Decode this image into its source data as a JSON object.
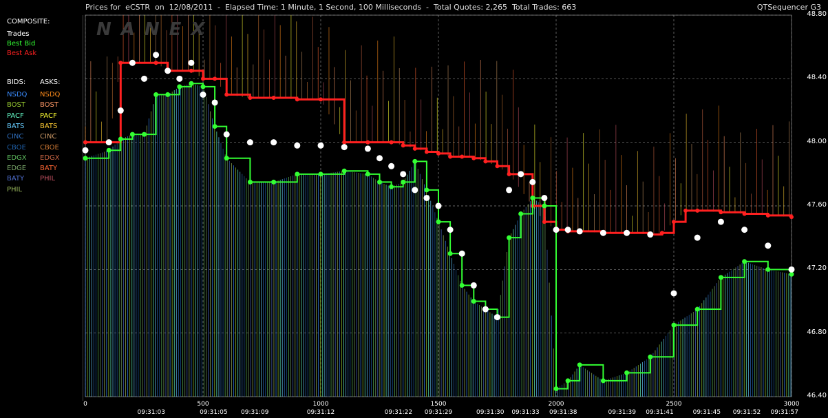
{
  "header": {
    "title": "Prices for  eCSTR  on  12/08/2011  -  Elapsed Time: 1 Minute, 1 Second, 100 Milliseconds  -  Total Quotes: 2,265  Total Trades: 663",
    "app": "QTSequencer G3",
    "watermark": "NANEX"
  },
  "legend": {
    "composite_label": "COMPOSITE:",
    "trades": "Trades",
    "best_bid": "Best Bid",
    "best_ask": "Best Ask",
    "bids_label": "BIDS:",
    "asks_label": "ASKS:",
    "bids": [
      "NSDQ",
      "BOST",
      "PACF",
      "BATS",
      "CINC",
      "CBOE",
      "EDGX",
      "EDGE",
      "BATY",
      "PHIL"
    ],
    "asks": [
      "NSDQ",
      "BOST",
      "PACF",
      "BATS",
      "CINC",
      "CBOE",
      "EDGX",
      "BATY",
      "PHIL"
    ],
    "bid_colors": [
      "#3a8cff",
      "#9acd32",
      "#66ffcc",
      "#66ccff",
      "#2f6fbf",
      "#1e5fa8",
      "#5fbf5f",
      "#7aa86a",
      "#4f6fd0",
      "#a0c060"
    ],
    "ask_colors": [
      "#ff8c1a",
      "#ff9966",
      "#ffff33",
      "#ffcc33",
      "#cc9966",
      "#cc7733",
      "#cc6644",
      "#ff6633",
      "#cc5566"
    ]
  },
  "colors": {
    "trades": "#ffffff",
    "best_bid": "#33ff33",
    "best_ask": "#ff2020",
    "grid": "#888888"
  },
  "chart_data": {
    "type": "line",
    "title": "",
    "ylim": [
      46.4,
      48.8
    ],
    "yticks": [
      "48.80",
      "48.40",
      "48.00",
      "47.60",
      "47.20",
      "46.80",
      "46.40"
    ],
    "xlim": [
      0,
      3000
    ],
    "xticks": [
      "0",
      "500",
      "1000",
      "1500",
      "2000",
      "2500",
      "3000"
    ],
    "time_labels": [
      {
        "x": 280,
        "label": "09:31:03"
      },
      {
        "x": 545,
        "label": "09:31:05"
      },
      {
        "x": 720,
        "label": "09:31:09"
      },
      {
        "x": 1000,
        "label": "09:31:12"
      },
      {
        "x": 1330,
        "label": "09:31:22"
      },
      {
        "x": 1500,
        "label": "09:31:29"
      },
      {
        "x": 1720,
        "label": "09:31:30"
      },
      {
        "x": 1870,
        "label": "09:31:33"
      },
      {
        "x": 2030,
        "label": "09:31:38"
      },
      {
        "x": 2280,
        "label": "09:31:39"
      },
      {
        "x": 2440,
        "label": "09:31:41"
      },
      {
        "x": 2640,
        "label": "09:31:45"
      },
      {
        "x": 2810,
        "label": "09:31:52"
      },
      {
        "x": 2970,
        "label": "09:31:57"
      }
    ],
    "series": [
      {
        "name": "Best Ask",
        "x": [
          0,
          100,
          150,
          300,
          350,
          450,
          500,
          550,
          600,
          700,
          800,
          900,
          1000,
          1100,
          1200,
          1300,
          1350,
          1400,
          1450,
          1500,
          1550,
          1600,
          1650,
          1700,
          1750,
          1800,
          1900,
          1950,
          2000,
          2050,
          2100,
          2200,
          2300,
          2400,
          2450,
          2500,
          2550,
          2600,
          2700,
          2800,
          2900,
          3000
        ],
        "values": [
          48.0,
          48.0,
          48.5,
          48.5,
          48.45,
          48.45,
          48.4,
          48.4,
          48.3,
          48.28,
          48.28,
          48.27,
          48.27,
          48.0,
          48.0,
          48.0,
          47.98,
          47.96,
          47.94,
          47.93,
          47.91,
          47.91,
          47.9,
          47.88,
          47.85,
          47.8,
          47.6,
          47.5,
          47.45,
          47.44,
          47.44,
          47.43,
          47.43,
          47.42,
          47.43,
          47.5,
          47.57,
          47.57,
          47.56,
          47.55,
          47.54,
          47.53
        ]
      },
      {
        "name": "Best Bid",
        "x": [
          0,
          100,
          150,
          200,
          250,
          300,
          350,
          400,
          450,
          500,
          550,
          600,
          700,
          800,
          900,
          1000,
          1100,
          1200,
          1250,
          1300,
          1350,
          1400,
          1450,
          1500,
          1550,
          1600,
          1650,
          1700,
          1750,
          1800,
          1850,
          1900,
          1950,
          2000,
          2050,
          2100,
          2200,
          2300,
          2400,
          2500,
          2600,
          2700,
          2800,
          2900,
          3000
        ],
        "values": [
          47.9,
          47.95,
          48.02,
          48.05,
          48.05,
          48.3,
          48.3,
          48.35,
          48.37,
          48.35,
          48.1,
          47.9,
          47.75,
          47.75,
          47.8,
          47.8,
          47.82,
          47.8,
          47.75,
          47.72,
          47.75,
          47.88,
          47.7,
          47.5,
          47.3,
          47.1,
          47.0,
          46.95,
          46.9,
          47.4,
          47.55,
          47.65,
          47.6,
          46.45,
          46.5,
          46.6,
          46.5,
          46.55,
          46.65,
          46.85,
          46.95,
          47.15,
          47.25,
          47.2,
          47.17
        ]
      },
      {
        "name": "Trades",
        "x": [
          0,
          100,
          150,
          200,
          250,
          300,
          350,
          400,
          450,
          500,
          550,
          600,
          700,
          800,
          900,
          1000,
          1100,
          1200,
          1250,
          1300,
          1350,
          1400,
          1450,
          1500,
          1550,
          1600,
          1650,
          1700,
          1750,
          1800,
          1850,
          1900,
          1950,
          2000,
          2050,
          2100,
          2200,
          2300,
          2400,
          2500,
          2600,
          2700,
          2800,
          2900,
          3000
        ],
        "values": [
          47.95,
          48.0,
          48.2,
          48.5,
          48.4,
          48.55,
          48.45,
          48.4,
          48.5,
          48.3,
          48.25,
          48.05,
          48.0,
          48.0,
          47.98,
          47.98,
          47.97,
          47.96,
          47.9,
          47.85,
          47.8,
          47.7,
          47.65,
          47.6,
          47.45,
          47.3,
          47.1,
          46.95,
          46.9,
          47.7,
          47.8,
          47.75,
          47.65,
          47.45,
          47.45,
          47.44,
          47.43,
          47.43,
          47.42,
          47.05,
          47.4,
          47.5,
          47.45,
          47.35,
          47.2
        ]
      }
    ]
  }
}
